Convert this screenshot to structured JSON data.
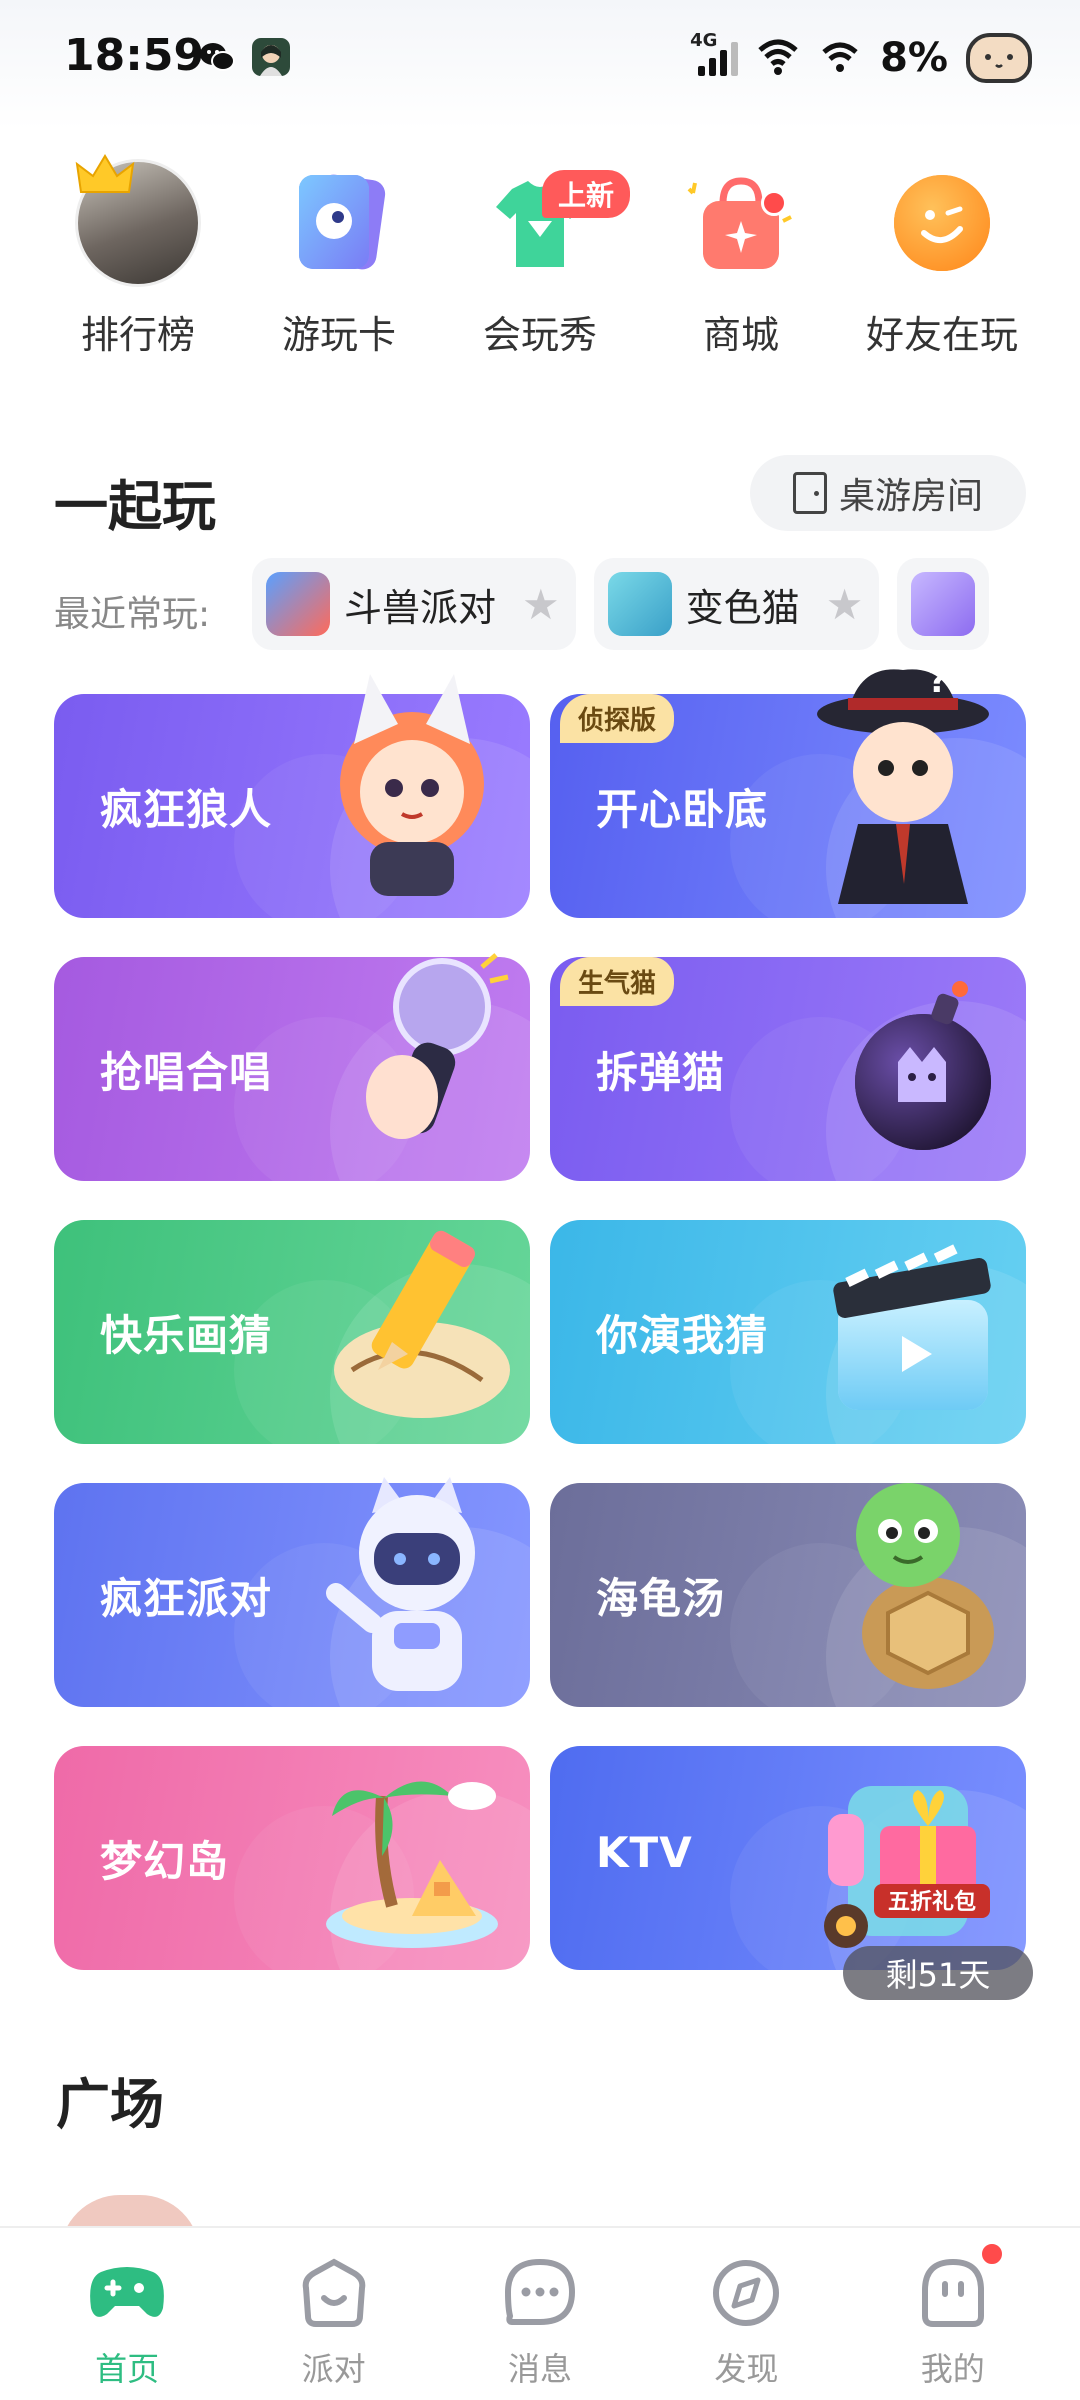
{
  "status_bar": {
    "time": "18:59",
    "network": "4G",
    "battery": "8%"
  },
  "shortcuts": [
    {
      "label": "排行榜",
      "icon": "ranking-avatar-icon"
    },
    {
      "label": "游玩卡",
      "icon": "play-card-icon"
    },
    {
      "label": "会玩秀",
      "icon": "tshirt-icon",
      "badge": "上新"
    },
    {
      "label": "商城",
      "icon": "shopping-bag-icon"
    },
    {
      "label": "好友在玩",
      "icon": "friend-smile-icon"
    }
  ],
  "section": {
    "title": "一起玩",
    "room_button": "桌游房间",
    "recent_label": "最近常玩:"
  },
  "recent_games": [
    {
      "name": "斗兽派对"
    },
    {
      "name": "变色猫"
    }
  ],
  "games": [
    {
      "name": "疯狂狼人",
      "tag": "",
      "color_from": "#7a5cf0",
      "color_to": "#9a7cff"
    },
    {
      "name": "开心卧底",
      "tag": "侦探版",
      "color_from": "#5660f0",
      "color_to": "#7c8cff"
    },
    {
      "name": "抢唱合唱",
      "tag": "",
      "color_from": "#a55ae0",
      "color_to": "#c07cf0"
    },
    {
      "name": "拆弹猫",
      "tag": "生气猫",
      "color_from": "#7a5cf0",
      "color_to": "#9c7af8"
    },
    {
      "name": "快乐画猜",
      "tag": "",
      "color_from": "#3ec17b",
      "color_to": "#66d699"
    },
    {
      "name": "你演我猜",
      "tag": "",
      "color_from": "#3bb7e8",
      "color_to": "#66d0f2"
    },
    {
      "name": "疯狂派对",
      "tag": "",
      "color_from": "#5e73f0",
      "color_to": "#8596ff"
    },
    {
      "name": "海龟汤",
      "tag": "",
      "color_from": "#6c6e9a",
      "color_to": "#8a8cb6"
    },
    {
      "name": "梦幻岛",
      "tag": "",
      "color_from": "#ef6aa8",
      "color_to": "#f78fbf"
    },
    {
      "name": "KTV",
      "tag": "",
      "color_from": "#4f6cf0",
      "color_to": "#7a8fff"
    }
  ],
  "ktv_promo": {
    "gift_text": "五折礼包",
    "timer": "剩51天"
  },
  "plaza": {
    "title": "广场"
  },
  "bottom_nav": [
    {
      "label": "首页",
      "active": true
    },
    {
      "label": "派对",
      "active": false
    },
    {
      "label": "消息",
      "active": false
    },
    {
      "label": "发现",
      "active": false
    },
    {
      "label": "我的",
      "active": false
    }
  ],
  "colors": {
    "accent": "#2ebd82",
    "badge_red": "#ff4b4b"
  }
}
